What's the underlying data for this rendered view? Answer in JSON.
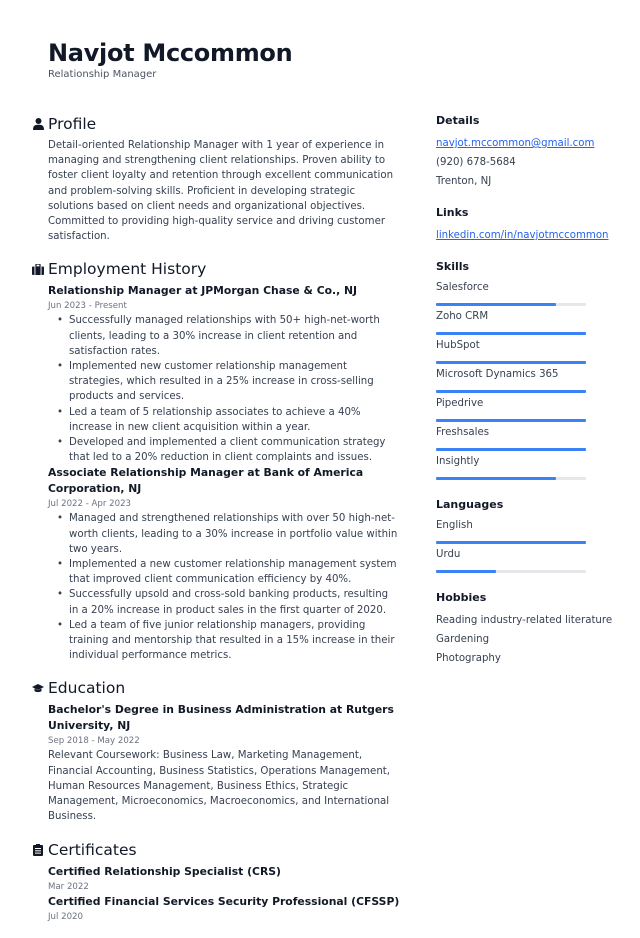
{
  "header": {
    "name": "Navjot Mccommon",
    "title": "Relationship Manager"
  },
  "profile": {
    "heading": "Profile",
    "icon": "user-icon",
    "text": "Detail-oriented Relationship Manager with 1 year of experience in managing and strengthening client relationships. Proven ability to foster client loyalty and retention through excellent communication and problem-solving skills. Proficient in developing strategic solutions based on client needs and organizational objectives. Committed to providing high-quality service and driving customer satisfaction."
  },
  "employment": {
    "heading": "Employment History",
    "icon": "briefcase-icon",
    "jobs": [
      {
        "title": "Relationship Manager at JPMorgan Chase & Co., NJ",
        "dates": "Jun 2023 - Present",
        "bullets": [
          "Successfully managed relationships with 50+ high-net-worth clients, leading to a 30% increase in client retention and satisfaction rates.",
          "Implemented new customer relationship management strategies, which resulted in a 25% increase in cross-selling products and services.",
          "Led a team of 5 relationship associates to achieve a 40% increase in new client acquisition within a year.",
          "Developed and implemented a client communication strategy that led to a 20% reduction in client complaints and issues."
        ]
      },
      {
        "title": "Associate Relationship Manager at Bank of America Corporation, NJ",
        "dates": "Jul 2022 - Apr 2023",
        "bullets": [
          "Managed and strengthened relationships with over 50 high-net-worth clients, leading to a 30% increase in portfolio value within two years.",
          "Implemented a new customer relationship management system that improved client communication efficiency by 40%.",
          "Successfully upsold and cross-sold banking products, resulting in a 20% increase in product sales in the first quarter of 2020.",
          "Led a team of five junior relationship managers, providing training and mentorship that resulted in a 15% increase in their individual performance metrics."
        ]
      }
    ]
  },
  "education": {
    "heading": "Education",
    "icon": "graduation-cap-icon",
    "entries": [
      {
        "title": "Bachelor's Degree in Business Administration at Rutgers University, NJ",
        "dates": "Sep 2018 - May 2022",
        "text": "Relevant Coursework: Business Law, Marketing Management, Financial Accounting, Business Statistics, Operations Management, Human Resources Management, Business Ethics, Strategic Management, Microeconomics, Macroeconomics, and International Business."
      }
    ]
  },
  "certificates": {
    "heading": "Certificates",
    "icon": "clipboard-icon",
    "items": [
      {
        "title": "Certified Relationship Specialist (CRS)",
        "date": "Mar 2022"
      },
      {
        "title": "Certified Financial Services Security Professional (CFSSP)",
        "date": "Jul 2020"
      }
    ]
  },
  "details": {
    "heading": "Details",
    "email": "navjot.mccommon@gmail.com",
    "phone": "(920) 678-5684",
    "location": "Trenton, NJ"
  },
  "links": {
    "heading": "Links",
    "items": [
      "linkedin.com/in/navjotmccommon"
    ]
  },
  "skills": {
    "heading": "Skills",
    "items": [
      {
        "name": "Salesforce",
        "level": 0.8
      },
      {
        "name": "Zoho CRM",
        "level": 1.0
      },
      {
        "name": "HubSpot",
        "level": 1.0
      },
      {
        "name": "Microsoft Dynamics 365",
        "level": 1.0
      },
      {
        "name": "Pipedrive",
        "level": 1.0
      },
      {
        "name": "Freshsales",
        "level": 1.0
      },
      {
        "name": "Insightly",
        "level": 0.8
      }
    ]
  },
  "languages": {
    "heading": "Languages",
    "items": [
      {
        "name": "English",
        "level": 1.0
      },
      {
        "name": "Urdu",
        "level": 0.4
      }
    ]
  },
  "hobbies": {
    "heading": "Hobbies",
    "items": [
      "Reading industry-related literature",
      "Gardening",
      "Photography"
    ]
  },
  "colors": {
    "accent": "#3b82f6",
    "bar_track": "#e5e7eb",
    "link": "#2563eb",
    "text": "#374151",
    "heading": "#111827"
  }
}
